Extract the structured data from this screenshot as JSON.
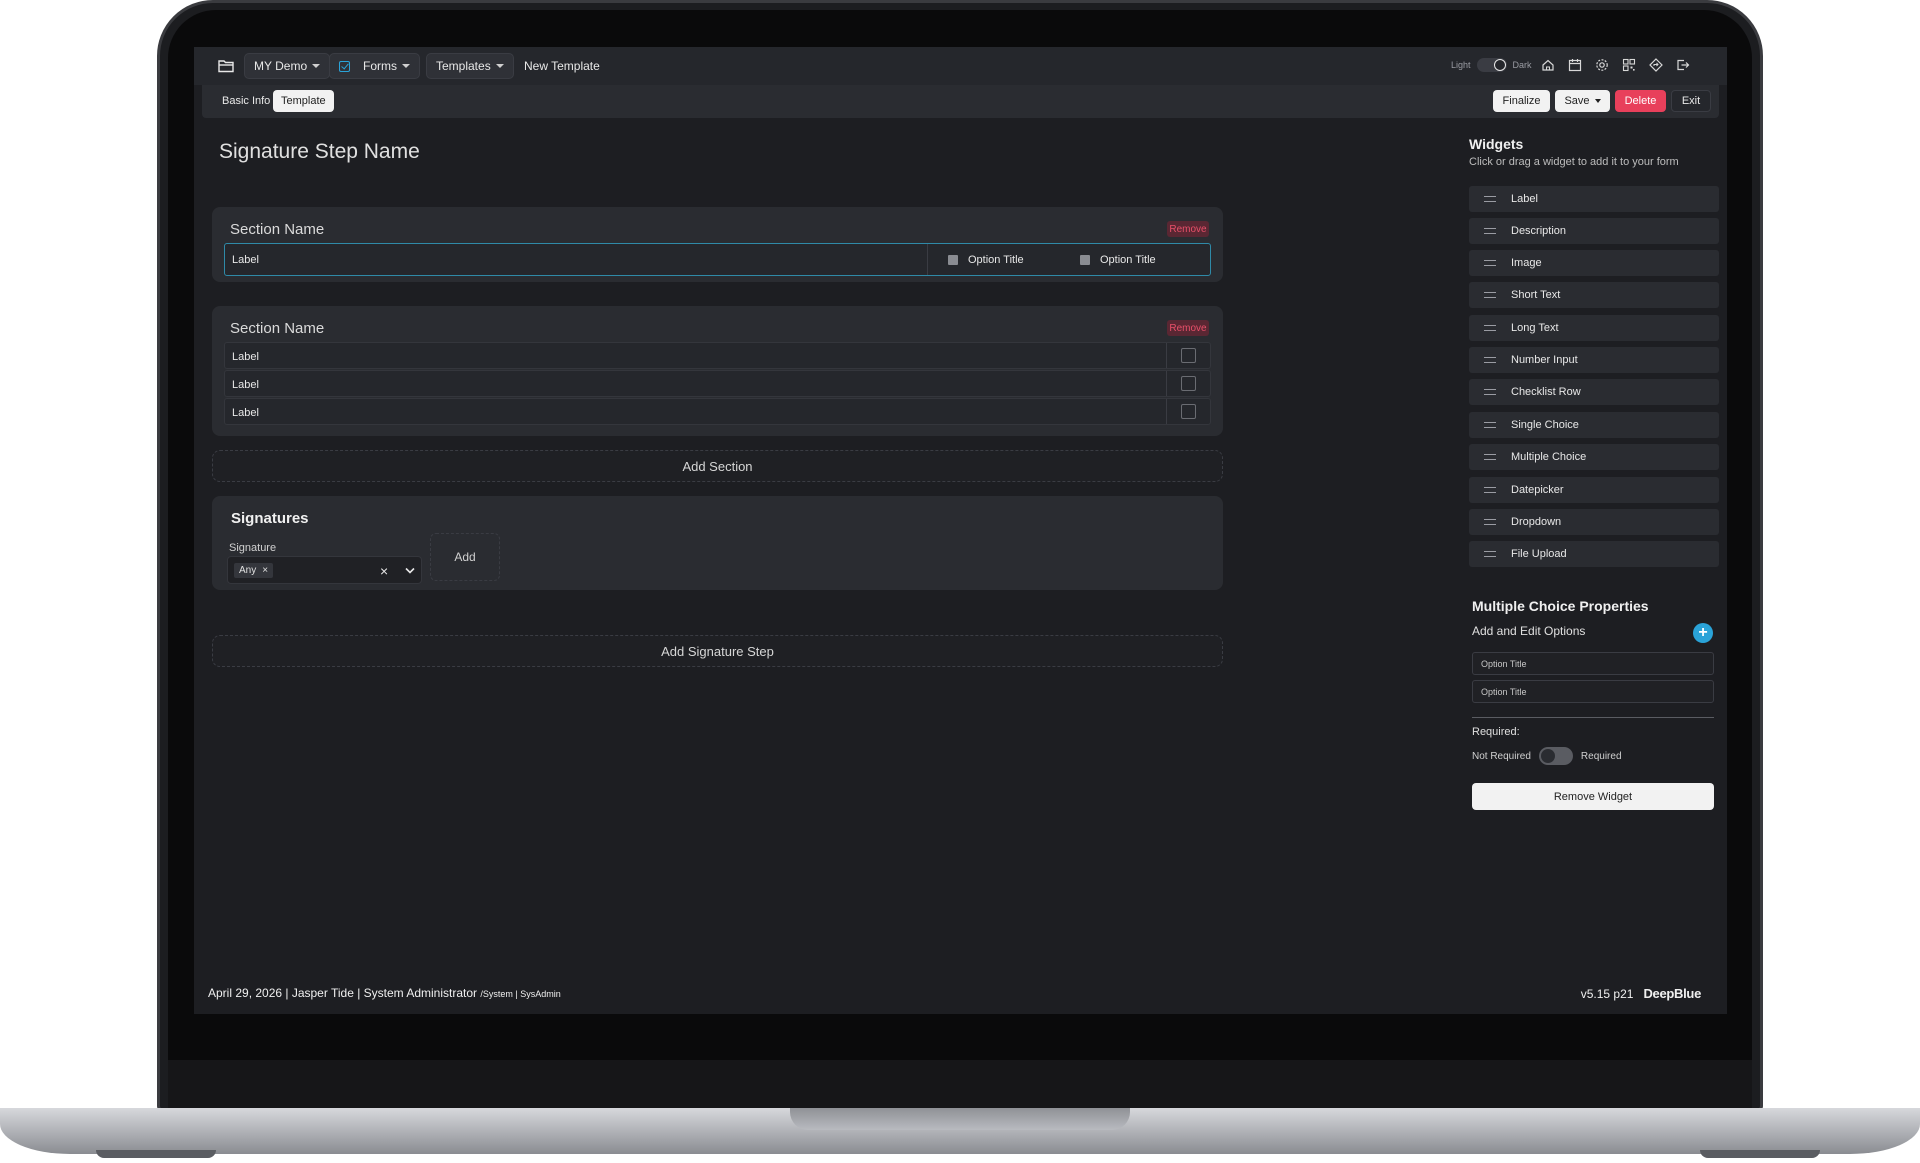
{
  "topnav": {
    "org": "MY Demo",
    "forms": "Forms",
    "templates": "Templates",
    "new_template": "New Template",
    "theme_light": "Light",
    "theme_dark": "Dark"
  },
  "subbar": {
    "tab_basic": "Basic Info",
    "tab_template": "Template",
    "finalize": "Finalize",
    "save": "Save",
    "delete": "Delete",
    "exit": "Exit"
  },
  "main": {
    "step_title": "Signature Step Name",
    "sections": [
      {
        "name": "Section Name",
        "remove": "Remove",
        "field_label": "Label",
        "options": [
          "Option Title",
          "Option Title"
        ]
      },
      {
        "name": "Section Name",
        "remove": "Remove",
        "rows": [
          "Label",
          "Label",
          "Label"
        ]
      }
    ],
    "add_section": "Add Section",
    "signatures": {
      "title": "Signatures",
      "label": "Signature",
      "chip": "Any",
      "chip_x": "×",
      "clear": "×",
      "add": "Add"
    },
    "add_signature_step": "Add Signature Step"
  },
  "widgets": {
    "title": "Widgets",
    "subtitle": "Click or drag a widget to add it to your form",
    "items": [
      "Label",
      "Description",
      "Image",
      "Short Text",
      "Long Text",
      "Number Input",
      "Checklist Row",
      "Single Choice",
      "Multiple Choice",
      "Datepicker",
      "Dropdown",
      "File Upload"
    ]
  },
  "properties": {
    "title": "Multiple Choice Properties",
    "subtitle": "Add and Edit Options",
    "plus": "+",
    "options": [
      "Option Title",
      "Option Title"
    ],
    "required_title": "Required:",
    "not_required": "Not Required",
    "required": "Required",
    "remove_widget": "Remove Widget"
  },
  "footer": {
    "left": "April 29, 2026 | Jasper Tide | System Administrator",
    "left_small": "/System | SysAdmin",
    "version": "v5.15 p21",
    "brand": "DeepBlue"
  },
  "colors": {
    "accent": "#2aa3d8",
    "danger": "#e8405b",
    "bg": "#1d1e22",
    "card": "#2a2c31"
  }
}
